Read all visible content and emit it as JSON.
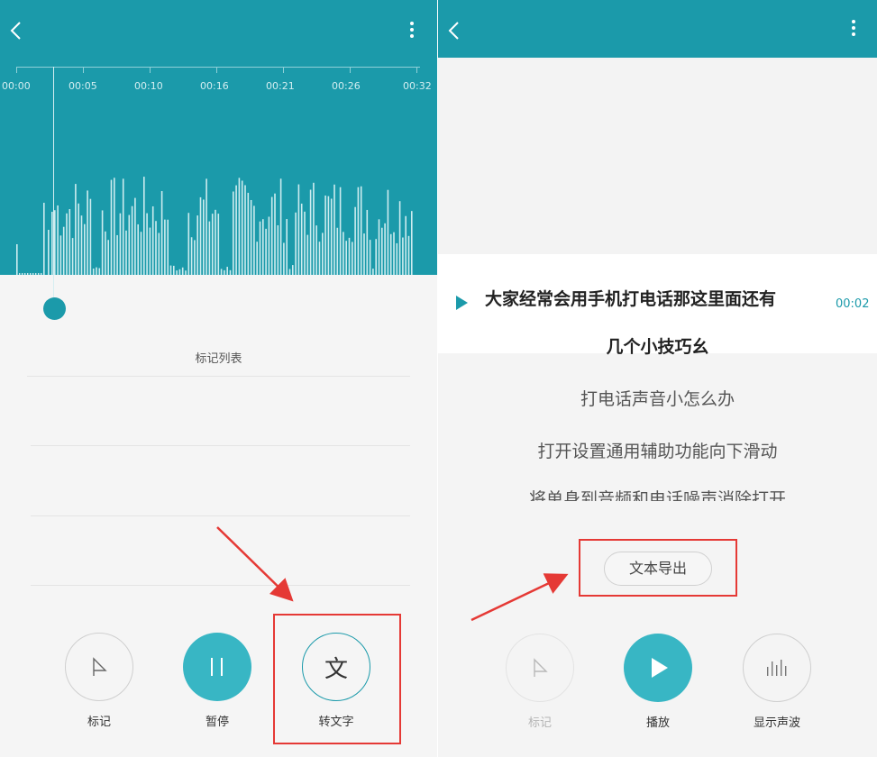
{
  "colors": {
    "accent": "#1b9aaa",
    "highlight": "#e53935"
  },
  "left": {
    "timeline_labels": [
      "00:00",
      "00:05",
      "00:10",
      "00:16",
      "00:21",
      "00:26",
      "00:32"
    ],
    "marks_title": "标记列表",
    "controls": {
      "mark": {
        "label": "标记",
        "icon": "flag-icon"
      },
      "pause": {
        "label": "暂停",
        "icon": "pause-icon"
      },
      "to_text": {
        "label": "转文字",
        "icon_text": "文"
      }
    }
  },
  "right": {
    "current": {
      "line1": "大家经常会用手机打电话那这里面还有",
      "line2": "几个小技巧幺",
      "time": "00:02"
    },
    "lines": [
      "打电话声音小怎么办",
      "打开设置通用辅助功能向下滑动",
      "将单身到音频和电话噪声消除打开"
    ],
    "export_label": "文本导出",
    "controls": {
      "mark": {
        "label": "标记",
        "icon": "flag-icon"
      },
      "play": {
        "label": "播放",
        "icon": "play-icon"
      },
      "waveform": {
        "label": "显示声波",
        "icon": "waveform-icon"
      }
    }
  }
}
